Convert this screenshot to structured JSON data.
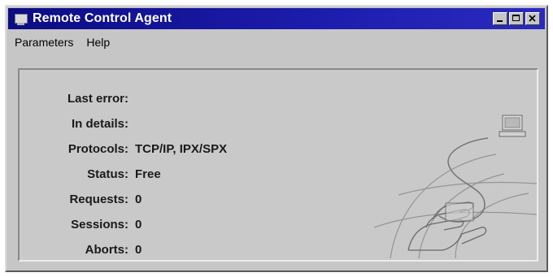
{
  "window": {
    "title": "Remote Control Agent",
    "icon": "computer-icon",
    "controls": [
      "minimize-icon",
      "maximize-icon",
      "close-icon"
    ]
  },
  "menu": {
    "items": [
      {
        "label": "Parameters"
      },
      {
        "label": "Help"
      }
    ]
  },
  "status_panel": {
    "rows": [
      {
        "label": "Last error:",
        "value": ""
      },
      {
        "label": "In details:",
        "value": ""
      },
      {
        "label": "Protocols:",
        "value": "TCP/IP, IPX/SPX"
      },
      {
        "label": "Status:",
        "value": "Free"
      },
      {
        "label": "Requests:",
        "value": "0"
      },
      {
        "label": "Sessions:",
        "value": "0"
      },
      {
        "label": "Aborts:",
        "value": "0"
      }
    ],
    "illustration": "hand-globe-computer-illustration"
  },
  "colors": {
    "titlebar": "#0c0c84",
    "face": "#c6c6c6"
  }
}
